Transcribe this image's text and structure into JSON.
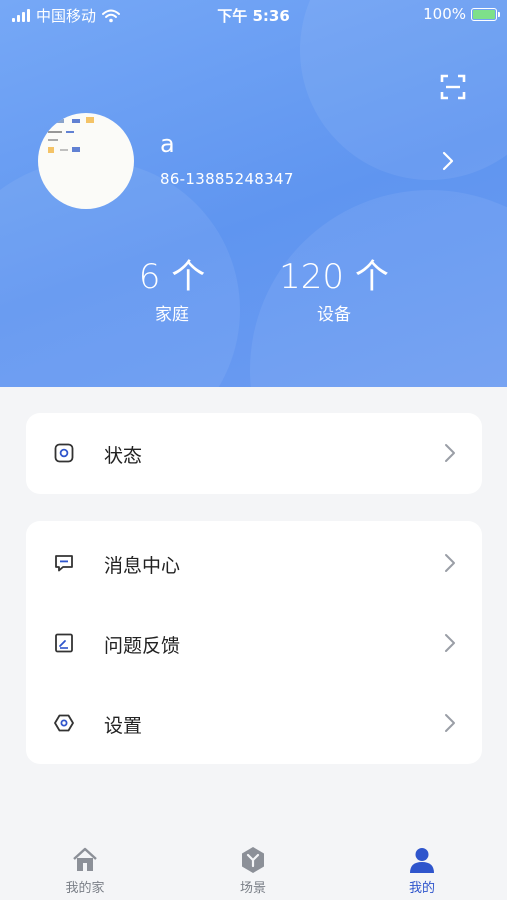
{
  "status_bar": {
    "carrier": "中国移动",
    "time": "下午 5:36",
    "battery": "100%"
  },
  "profile": {
    "username": "a",
    "phone": "86-13885248347"
  },
  "stats": [
    {
      "value": "6 个",
      "label": "家庭"
    },
    {
      "value": "120 个",
      "label": "设备"
    }
  ],
  "menu_status": {
    "label": "状态"
  },
  "menu_main": [
    {
      "label": "消息中心"
    },
    {
      "label": "问题反馈"
    },
    {
      "label": "设置"
    }
  ],
  "tabs": [
    {
      "label": "我的家",
      "icon": "home-icon"
    },
    {
      "label": "场景",
      "icon": "scene-icon"
    },
    {
      "label": "我的",
      "icon": "user-icon",
      "active": true
    }
  ],
  "colors": {
    "header_blue": "#6a9ff3",
    "active_tab": "#2f55cc",
    "background": "#f4f5f7"
  }
}
